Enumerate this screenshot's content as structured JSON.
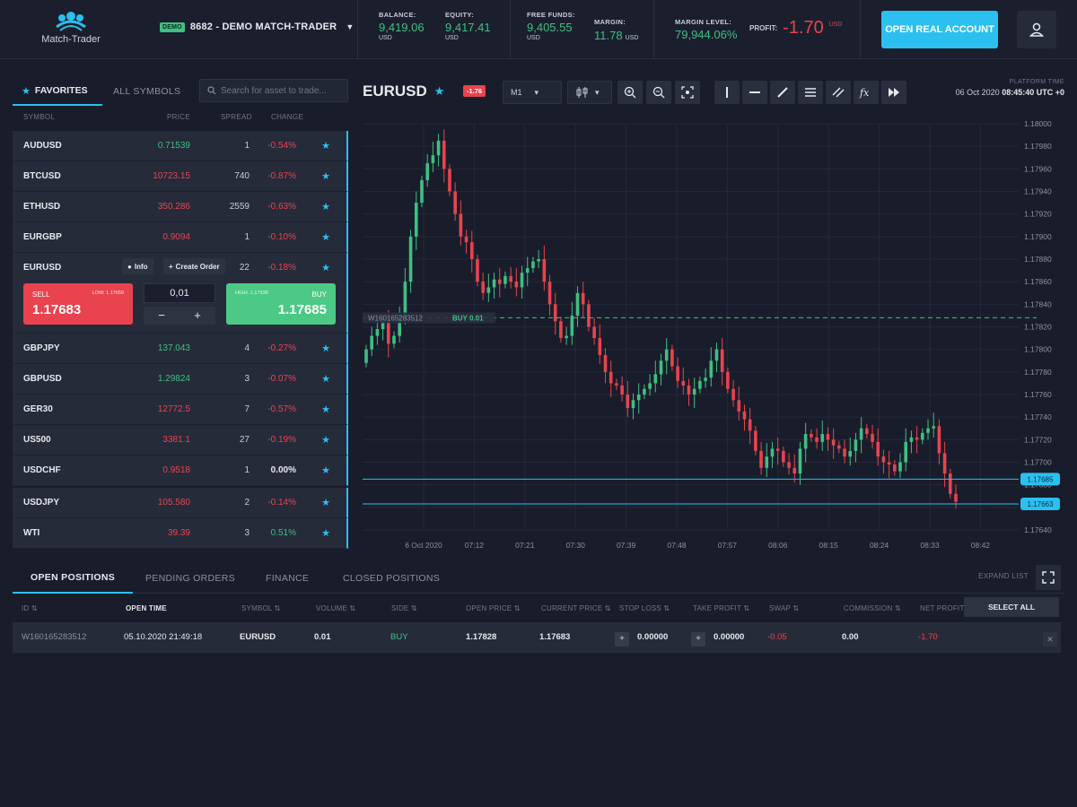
{
  "header": {
    "logo_text": "Match-Trader",
    "demo_badge": "DEMO",
    "account_label": "8682 - DEMO MATCH-TRADER",
    "stats": [
      {
        "label": "BALANCE:",
        "value": "9,419.06",
        "unit": "USD"
      },
      {
        "label": "EQUITY:",
        "value": "9,417.41",
        "unit": "USD"
      },
      {
        "label": "FREE FUNDS:",
        "value": "9,405.55",
        "unit": "USD"
      },
      {
        "label": "MARGIN:",
        "value": "11.78",
        "unit": "USD"
      },
      {
        "label": "MARGIN LEVEL:",
        "value": "79,944.06%"
      }
    ],
    "profit": {
      "label": "PROFIT:",
      "value": "-1.70",
      "unit": "USD"
    },
    "open_real_label": "OPEN REAL ACCOUNT",
    "colors": {
      "accent": "#2bc0f0",
      "up": "#3fbf83",
      "down": "#e8434f",
      "bg": "#191d2b"
    }
  },
  "symbols_panel": {
    "tab_favorites": "FAVORITES",
    "tab_all": "ALL SYMBOLS",
    "search_placeholder": "Search for asset to trade...",
    "columns": {
      "symbol": "SYMBOL",
      "price": "PRICE",
      "spread": "SPREAD",
      "change": "CHANGE"
    },
    "rows": [
      {
        "name": "AUDUSD",
        "price": "0.71539",
        "price_dir": "up",
        "spread": "1",
        "change": "-0.54%",
        "change_dir": "down"
      },
      {
        "name": "BTCUSD",
        "price": "10723.15",
        "price_dir": "down",
        "spread": "740",
        "change": "-0.87%",
        "change_dir": "down"
      },
      {
        "name": "ETHUSD",
        "price": "350.286",
        "price_dir": "down",
        "spread": "2559",
        "change": "-0.63%",
        "change_dir": "down"
      },
      {
        "name": "EURGBP",
        "price": "0.9094",
        "price_dir": "down",
        "spread": "1",
        "change": "-0.10%",
        "change_dir": "down"
      }
    ],
    "expanded": {
      "name": "EURUSD",
      "info_label": "Info",
      "create_order_label": "Create Order",
      "spread": "22",
      "change": "-0.18%",
      "sell_label": "SELL",
      "sell_sub": "LOW: 1.17659",
      "sell_price": "1.17683",
      "buy_label": "BUY",
      "buy_sub": "HIGH: 1.17938",
      "buy_price": "1.17685",
      "volume": "0,01",
      "minus": "−",
      "plus": "+"
    },
    "rows_after": [
      {
        "name": "GBPJPY",
        "price": "137.043",
        "price_dir": "up",
        "spread": "4",
        "change": "-0.27%",
        "change_dir": "down"
      },
      {
        "name": "GBPUSD",
        "price": "1.29824",
        "price_dir": "up",
        "spread": "3",
        "change": "-0.07%",
        "change_dir": "down"
      },
      {
        "name": "GER30",
        "price": "12772.5",
        "price_dir": "down",
        "spread": "7",
        "change": "-0.57%",
        "change_dir": "down"
      },
      {
        "name": "US500",
        "price": "3381.1",
        "price_dir": "down",
        "spread": "27",
        "change": "-0.19%",
        "change_dir": "down"
      },
      {
        "name": "USDCHF",
        "price": "0.9518",
        "price_dir": "down",
        "spread": "1",
        "change": "0.00%",
        "change_dir": "neutral"
      },
      {
        "name": "USDJPY",
        "price": "105.580",
        "price_dir": "down",
        "spread": "2",
        "change": "-0.14%",
        "change_dir": "down"
      },
      {
        "name": "WTI",
        "price": "39.39",
        "price_dir": "down",
        "spread": "3",
        "change": "0.51%",
        "change_dir": "up"
      }
    ]
  },
  "chart_toolbar": {
    "symbol": "EURUSD",
    "change_badge": "-1.76",
    "timeframe": "M1",
    "platform_time_label": "PLATFORM TIME",
    "platform_date": "06 Oct 2020",
    "platform_time": "08:45:40 UTC +0"
  },
  "chart_data": {
    "type": "candlestick",
    "y_ticks": [
      "1.18000",
      "1.17980",
      "1.17960",
      "1.17940",
      "1.17920",
      "1.17900",
      "1.17880",
      "1.17860",
      "1.17840",
      "1.17820",
      "1.17800",
      "1.17780",
      "1.17760",
      "1.17740",
      "1.17720",
      "1.17700",
      "1.17680",
      "1.17660",
      "1.17640"
    ],
    "x_ticks": [
      "6 Oct 2020",
      "07:12",
      "07:21",
      "07:30",
      "07:39",
      "07:48",
      "07:57",
      "08:06",
      "08:15",
      "08:24",
      "08:33",
      "08:42"
    ],
    "ylim": [
      1.1764,
      1.18
    ],
    "position_line": {
      "price": 1.17828,
      "label_id": "W160165283512",
      "label_side": "BUY 0.01"
    },
    "ask_line": {
      "price": 1.17685,
      "label": "1.17685"
    },
    "bid_line": {
      "price": 1.17663,
      "label": "1.17663"
    },
    "closes": [
      1.178,
      1.17812,
      1.17818,
      1.17825,
      1.17805,
      1.17812,
      1.1783,
      1.1786,
      1.179,
      1.1793,
      1.1795,
      1.17965,
      1.17972,
      1.17985,
      1.1796,
      1.1794,
      1.1792,
      1.179,
      1.17895,
      1.1788,
      1.1786,
      1.1785,
      1.17855,
      1.17862,
      1.17858,
      1.17865,
      1.1786,
      1.17855,
      1.17868,
      1.17872,
      1.17878,
      1.1788,
      1.1786,
      1.1784,
      1.17825,
      1.1781,
      1.17812,
      1.1783,
      1.1785,
      1.1784,
      1.1782,
      1.1781,
      1.17795,
      1.1778,
      1.1777,
      1.17768,
      1.1776,
      1.17748,
      1.17755,
      1.1776,
      1.17765,
      1.1777,
      1.17778,
      1.1779,
      1.178,
      1.17785,
      1.17772,
      1.17768,
      1.1776,
      1.17765,
      1.17772,
      1.17775,
      1.1779,
      1.178,
      1.1778,
      1.17765,
      1.17755,
      1.17745,
      1.17738,
      1.17728,
      1.1771,
      1.17695,
      1.17705,
      1.17712,
      1.1771,
      1.177,
      1.17695,
      1.1769,
      1.17712,
      1.17725,
      1.17722,
      1.17718,
      1.17725,
      1.1772,
      1.17715,
      1.17712,
      1.17705,
      1.1771,
      1.1772,
      1.1773,
      1.17725,
      1.17718,
      1.17705,
      1.177,
      1.17698,
      1.17692,
      1.177,
      1.17718,
      1.17722,
      1.1772,
      1.17726,
      1.1773,
      1.17732,
      1.17708,
      1.1769,
      1.17672,
      1.17665
    ]
  },
  "bottom_panel": {
    "tabs": [
      "OPEN POSITIONS",
      "PENDING ORDERS",
      "FINANCE",
      "CLOSED POSITIONS"
    ],
    "expand_label": "EXPAND LIST",
    "columns": [
      "ID ⇅",
      "OPEN TIME",
      "SYMBOL ⇅",
      "VOLUME ⇅",
      "SIDE ⇅",
      "OPEN PRICE ⇅",
      "CURRENT PRICE ⇅",
      "STOP LOSS ⇅",
      "TAKE PROFIT ⇅",
      "SWAP ⇅",
      "COMMISSION ⇅",
      "NET PROFIT"
    ],
    "select_all_label": "SELECT ALL",
    "position": {
      "id": "W160165283512",
      "open_time": "05.10.2020 21:49:18",
      "symbol": "EURUSD",
      "volume": "0.01",
      "side": "BUY",
      "open_price": "1.17828",
      "current_price": "1.17683",
      "stop_loss": "0.00000",
      "take_profit": "0.00000",
      "swap": "-0.05",
      "commission": "0.00",
      "net_profit": "-1.70"
    }
  }
}
